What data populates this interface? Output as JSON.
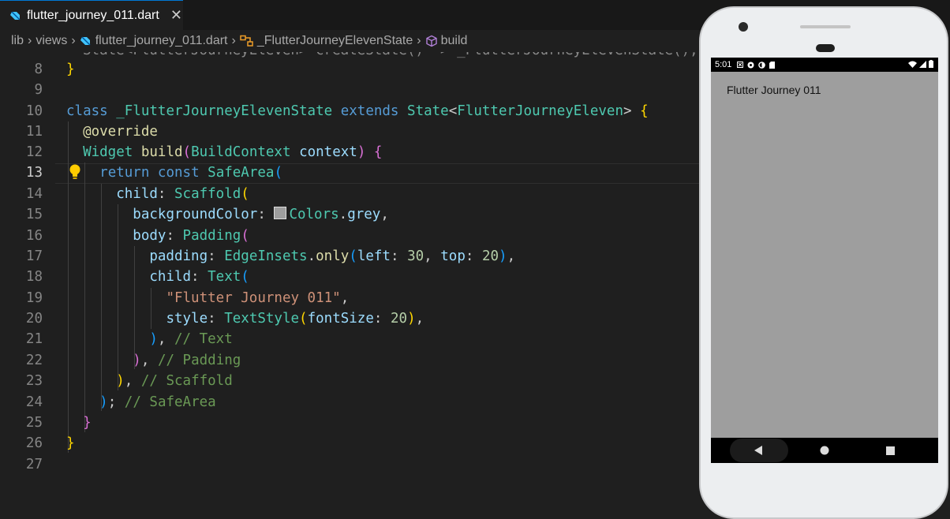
{
  "tab": {
    "filename": "flutter_journey_011.dart",
    "close": "✕"
  },
  "breadcrumb": {
    "items": [
      "lib",
      "views",
      "flutter_journey_011.dart",
      "_FlutterJourneyElevenState",
      "build"
    ],
    "separator": "›"
  },
  "editor": {
    "line_numbers": [
      "8",
      "9",
      "10",
      "11",
      "12",
      "13",
      "14",
      "15",
      "16",
      "17",
      "18",
      "19",
      "20",
      "21",
      "22",
      "23",
      "24",
      "25",
      "26",
      "27"
    ],
    "active_line": "13",
    "partial_line": "State<FlutterJourneyEleven> createState() => _FlutterJourneyElevenState();",
    "tokens": {
      "class_kw": "class",
      "class_name": "_FlutterJourneyElevenState",
      "extends_kw": "extends",
      "state_type": "State",
      "lt": "<",
      "generic_type": "FlutterJourneyEleven",
      "gt": ">",
      "override": "@override",
      "widget_type": "Widget",
      "build_fn": "build",
      "build_context_type": "BuildContext",
      "context_param": "context",
      "return_kw": "return",
      "const_kw": "const",
      "safe_area": "SafeArea",
      "child_param": "child",
      "scaffold": "Scaffold",
      "background_color_param": "backgroundColor",
      "colors_class": "Colors",
      "grey_prop": "grey",
      "body_param": "body",
      "padding_class": "Padding",
      "padding_param": "padding",
      "edge_insets": "EdgeInsets",
      "only_fn": "only",
      "left_param": "left",
      "left_value": "30",
      "top_param": "top",
      "top_value": "20",
      "text_class": "Text",
      "text_string": "\"Flutter Journey 011\"",
      "style_param": "style",
      "text_style": "TextStyle",
      "font_size_param": "fontSize",
      "font_size_value": "20",
      "comment_text": "// Text",
      "comment_padding": "// Padding",
      "comment_scaffold": "// Scaffold",
      "comment_safearea": "// SafeArea"
    }
  },
  "emulator": {
    "status_time": "5:01",
    "app_text": "Flutter Journey 011",
    "screen_background": "#9e9e9e"
  },
  "colors": {
    "editor_bg": "#1f1f1f",
    "keyword": "#569cd6",
    "type": "#4ec9b0",
    "function": "#dcdcaa",
    "identifier": "#9cdcfe",
    "string": "#ce9178",
    "number": "#b5cea8",
    "comment": "#6a9955"
  }
}
